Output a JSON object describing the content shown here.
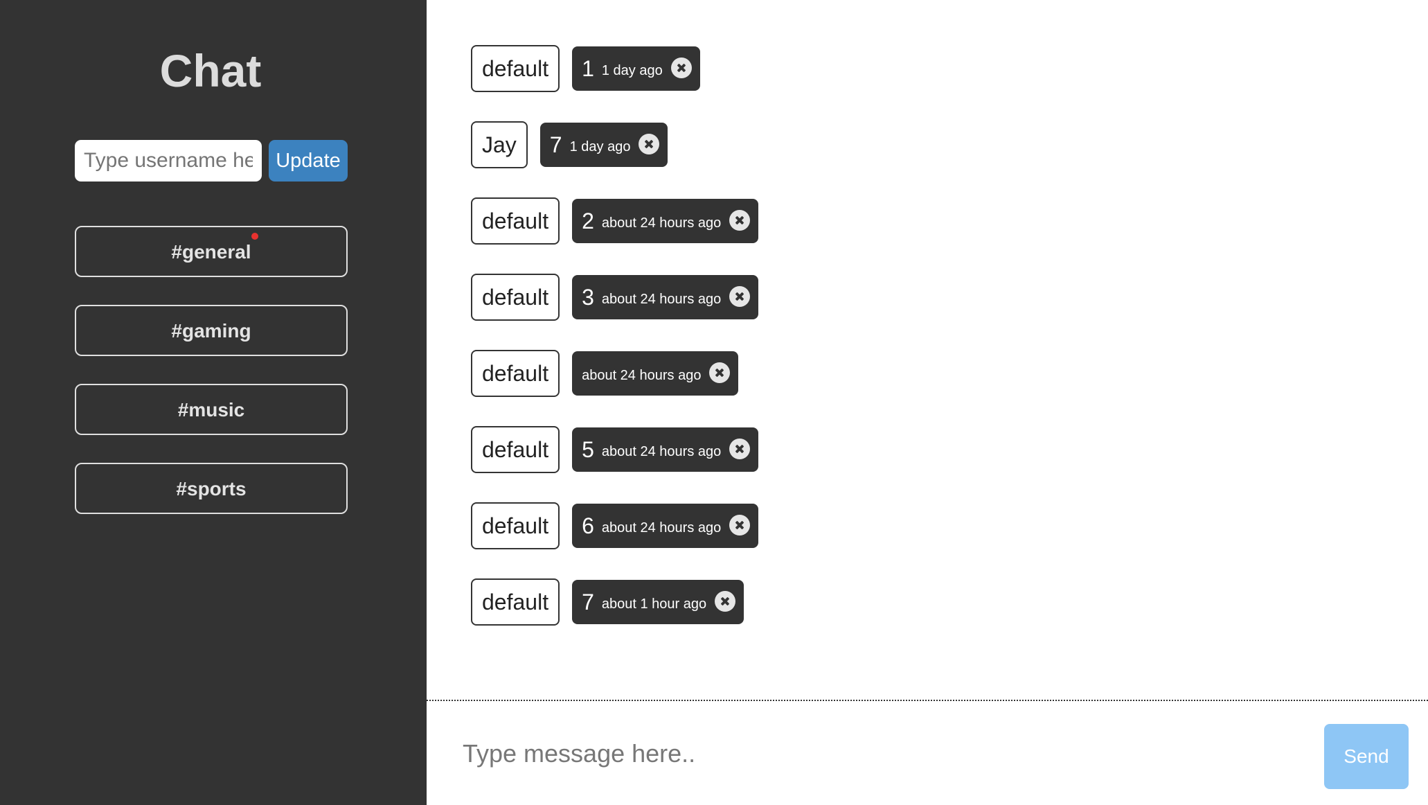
{
  "sidebar": {
    "title": "Chat",
    "username_placeholder": "Type username here",
    "update_label": "Update",
    "channels": [
      {
        "label": "#general",
        "unread": true
      },
      {
        "label": "#gaming",
        "unread": false
      },
      {
        "label": "#music",
        "unread": false
      },
      {
        "label": "#sports",
        "unread": false
      }
    ]
  },
  "messages": [
    {
      "author": "default",
      "text": "1",
      "time": "1 day ago"
    },
    {
      "author": "Jay",
      "text": "7",
      "time": "1 day ago"
    },
    {
      "author": "default",
      "text": "2",
      "time": "about 24 hours ago"
    },
    {
      "author": "default",
      "text": "3",
      "time": "about 24 hours ago"
    },
    {
      "author": "default",
      "text": "",
      "time": "about 24 hours ago"
    },
    {
      "author": "default",
      "text": "5",
      "time": "about 24 hours ago"
    },
    {
      "author": "default",
      "text": "6",
      "time": "about 24 hours ago"
    },
    {
      "author": "default",
      "text": "7",
      "time": "about 1 hour ago"
    }
  ],
  "composer": {
    "placeholder": "Type message here..",
    "send_label": "Send"
  },
  "colors": {
    "sidebar_bg": "#333333",
    "update_button": "#3c82bf",
    "unread_dot": "#e8322f",
    "send_button": "#8ec6f5"
  }
}
